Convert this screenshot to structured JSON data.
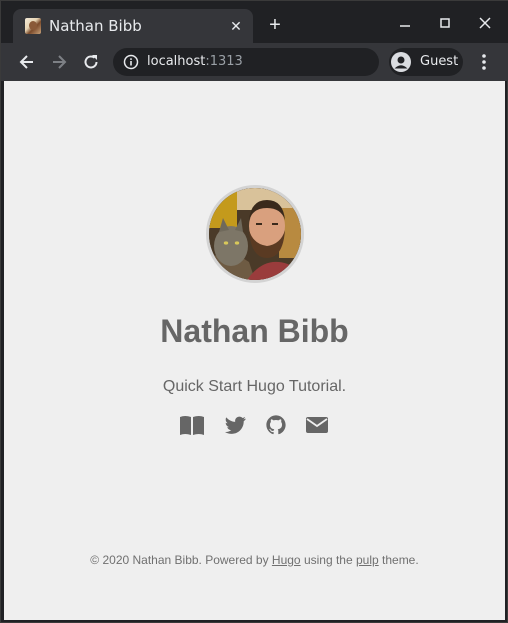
{
  "browser": {
    "tab_title": "Nathan Bibb",
    "url_host": "localhost",
    "url_port": ":1313",
    "profile_label": "Guest"
  },
  "page": {
    "site_title": "Nathan Bibb",
    "description": "Quick Start Hugo Tutorial.",
    "social_icons": [
      "book-icon",
      "twitter-icon",
      "github-icon",
      "envelope-icon"
    ],
    "footer": {
      "prefix": "© 2020 Nathan Bibb. Powered by ",
      "hugo_link": "Hugo",
      "middle": " using the ",
      "theme_link": "pulp",
      "suffix": " theme."
    }
  },
  "colors": {
    "page_background": "#efefef",
    "text": "#666666",
    "chrome_dark": "#202124",
    "chrome_toolbar": "#35363a"
  }
}
